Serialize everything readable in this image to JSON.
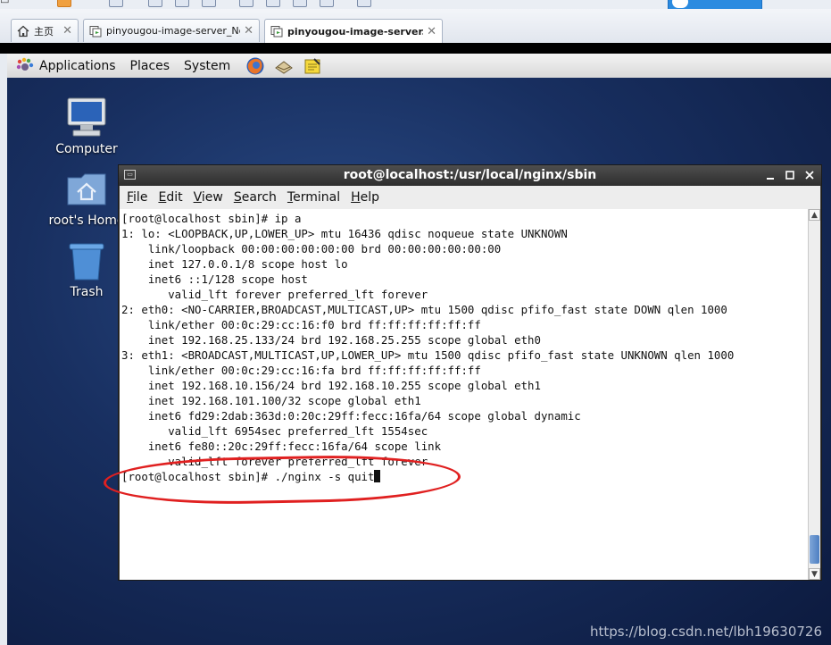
{
  "vmware": {
    "tabs": [
      {
        "label": "主页",
        "icon": "home-icon",
        "active": false
      },
      {
        "label": "pinyougou-image-server_Ngin...",
        "icon": "vm-icon",
        "active": false
      },
      {
        "label": "pinyougou-image-server...",
        "icon": "vm-icon",
        "active": true
      }
    ],
    "close_glyph": "✕"
  },
  "gnome_panel": {
    "menus": [
      "Applications",
      "Places",
      "System"
    ],
    "launchers": [
      "firefox-icon",
      "mail-icon",
      "notes-icon"
    ]
  },
  "desktop": {
    "icons": [
      {
        "label": "Computer",
        "icon": "computer-icon"
      },
      {
        "label": "root's Home",
        "icon": "home-folder-icon"
      },
      {
        "label": "Trash",
        "icon": "trash-icon"
      }
    ]
  },
  "terminal": {
    "title": "root@localhost:/usr/local/nginx/sbin",
    "menus": [
      {
        "mnemonic": "F",
        "rest": "ile"
      },
      {
        "mnemonic": "E",
        "rest": "dit"
      },
      {
        "mnemonic": "V",
        "rest": "iew"
      },
      {
        "mnemonic": "S",
        "rest": "earch"
      },
      {
        "mnemonic": "T",
        "rest": "erminal"
      },
      {
        "mnemonic": "H",
        "rest": "elp"
      }
    ],
    "output_lines": [
      "[root@localhost sbin]# ip a",
      "1: lo: <LOOPBACK,UP,LOWER_UP> mtu 16436 qdisc noqueue state UNKNOWN",
      "    link/loopback 00:00:00:00:00:00 brd 00:00:00:00:00:00",
      "    inet 127.0.0.1/8 scope host lo",
      "    inet6 ::1/128 scope host",
      "       valid_lft forever preferred_lft forever",
      "2: eth0: <NO-CARRIER,BROADCAST,MULTICAST,UP> mtu 1500 qdisc pfifo_fast state DOWN qlen 1000",
      "    link/ether 00:0c:29:cc:16:f0 brd ff:ff:ff:ff:ff:ff",
      "    inet 192.168.25.133/24 brd 192.168.25.255 scope global eth0",
      "3: eth1: <BROADCAST,MULTICAST,UP,LOWER_UP> mtu 1500 qdisc pfifo_fast state UNKNOWN qlen 1000",
      "    link/ether 00:0c:29:cc:16:fa brd ff:ff:ff:ff:ff:ff",
      "    inet 192.168.10.156/24 brd 192.168.10.255 scope global eth1",
      "    inet 192.168.101.100/32 scope global eth1",
      "    inet6 fd29:2dab:363d:0:20c:29ff:fecc:16fa/64 scope global dynamic",
      "       valid_lft 6954sec preferred_lft 1554sec",
      "    inet6 fe80::20c:29ff:fecc:16fa/64 scope link",
      "       valid_lft forever preferred_lft forever"
    ],
    "prompt": "[root@localhost sbin]# ",
    "command": "./nginx -s quit"
  },
  "watermark": "https://blog.csdn.net/lbh19630726",
  "colors": {
    "annotation_red": "#e02020",
    "desktop_blue": "#182f60"
  }
}
